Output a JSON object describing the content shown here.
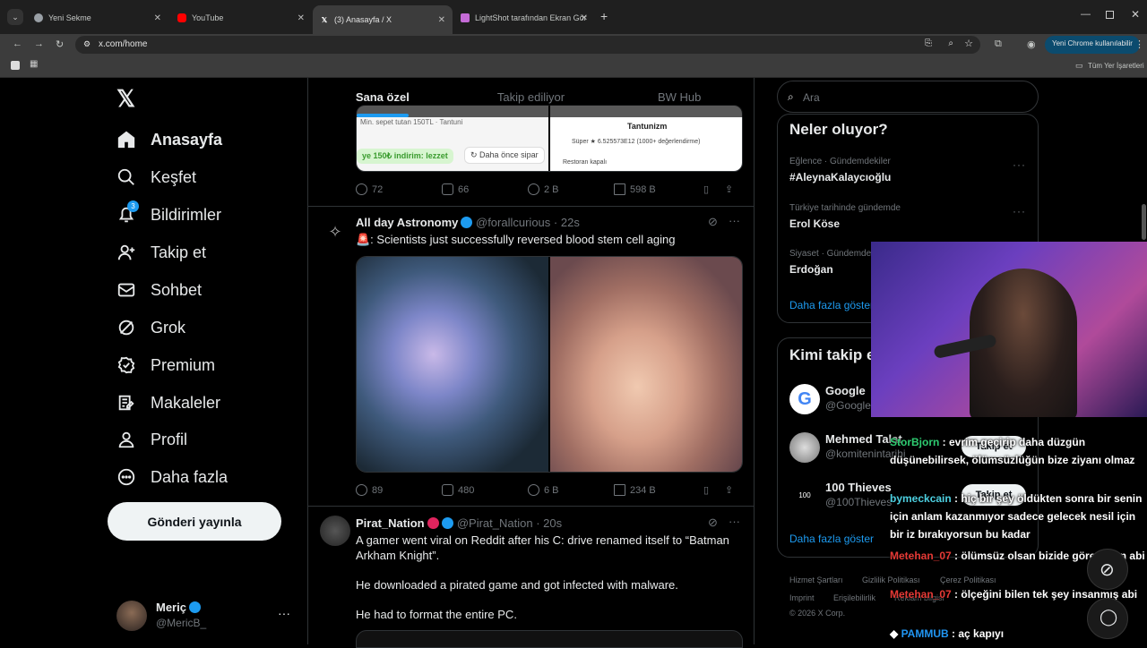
{
  "browser": {
    "tabs": [
      {
        "title": "Yeni Sekme",
        "active": false
      },
      {
        "title": "YouTube",
        "active": false
      },
      {
        "title": "(3) Anasayfa / X",
        "active": true
      },
      {
        "title": "LightShot tarafından Ekran Gör",
        "active": false
      }
    ],
    "url": "x.com/home",
    "profile_label": "Yeni Chrome kullanılabilir",
    "bookmarks_all": "Tüm Yer İşaretleri"
  },
  "nav": {
    "items": [
      {
        "label": "Anasayfa",
        "icon": "home-icon"
      },
      {
        "label": "Keşfet",
        "icon": "search-icon"
      },
      {
        "label": "Bildirimler",
        "icon": "bell-icon",
        "badge": "3"
      },
      {
        "label": "Takip et",
        "icon": "follow-icon"
      },
      {
        "label": "Sohbet",
        "icon": "mail-icon"
      },
      {
        "label": "Grok",
        "icon": "grok-icon"
      },
      {
        "label": "Premium",
        "icon": "premium-icon"
      },
      {
        "label": "Makaleler",
        "icon": "articles-icon"
      },
      {
        "label": "Profil",
        "icon": "profile-icon"
      },
      {
        "label": "Daha fazla",
        "icon": "more-icon"
      }
    ],
    "post_button": "Gönderi yayınla",
    "account": {
      "name": "Meriç",
      "handle": "@MericB_"
    }
  },
  "feed": {
    "tabs": [
      "Sana özel",
      "Takip ediliyor",
      "BW Hub"
    ],
    "prev_post": {
      "card_left_top": "Min. sepet tutan 150TL · Tantuni",
      "card_left_promo": "ye 150₺ indirim: lezzet",
      "card_left_reorder": "Daha önce sipar",
      "card_right_title": "Tantunizm",
      "card_right_rating": "Süper ★ 6.525573E12 (1000+ değerlendirme)",
      "card_right_status": "Restoran kapalı",
      "replies": "72",
      "reposts": "66",
      "likes": "2 B",
      "views": "598 B"
    },
    "posts": [
      {
        "name": "All day Astronomy",
        "handle": "@forallcurious",
        "time": "22s",
        "text": "🚨: Scientists just successfully reversed blood stem cell aging",
        "replies": "89",
        "reposts": "480",
        "likes": "6 B",
        "views": "234 B"
      },
      {
        "name": "Pirat_Nation",
        "handle": "@Pirat_Nation",
        "time": "20s",
        "text1": "A gamer went viral on Reddit after his C: drive renamed itself to “Batman Arkham Knight”.",
        "text2": "He downloaded a pirated game and got infected with malware.",
        "text3": "He had to format the entire PC."
      }
    ]
  },
  "sidebar": {
    "search_placeholder": "Ara",
    "trends_title": "Neler oluyor?",
    "trends": [
      {
        "category": "Eğlence · Gündemdekiler",
        "name": "#AleynaKalaycıoğlu"
      },
      {
        "category": "Türkiye tarihinde gündemde",
        "name": "Erol Köse"
      },
      {
        "category": "Siyaset · Gündemde",
        "name": "Erdoğan"
      }
    ],
    "show_more": "Daha fazla göster",
    "who_title": "Kimi takip et",
    "who": [
      {
        "name": "Google",
        "handle": "@Google"
      },
      {
        "name": "Mehmed Talat",
        "handle": "@komitenintarihi"
      },
      {
        "name": "100 Thieves",
        "handle": "@100Thieves"
      }
    ],
    "follow_label": "Takip et",
    "show_more2": "Daha fazla göster",
    "footer": [
      "Hizmet Şartları",
      "Gizlilik Politikası",
      "Çerez Politikası",
      "Imprint",
      "Erişilebilirlik",
      "Reklam bilgisi",
      "© 2026 X Corp."
    ]
  },
  "chat": [
    {
      "user": "StorBjorn",
      "color": "#2ecc71",
      "msg": " : evrim geçirip daha düzgün düşünebilirsek, ölümsüzlüğün bize ziyanı olmaz"
    },
    {
      "user": "bymeckcain",
      "color": "#4dd0e1",
      "msg": " : hiç bir şey öldükten sonra bir senin için anlam kazanmıyor sadece gelecek nesil için bir iz bırakıyorsun bu kadar"
    },
    {
      "user": "Metehan_07",
      "color": "#e53935",
      "msg": " : ölümsüz olsan bizide göremicen abi"
    },
    {
      "user": "Metehan_07",
      "color": "#e53935",
      "msg": " : ölçeğini bilen tek şey insanmış abi"
    },
    {
      "user": "PAMMUB",
      "color": "#2196f3",
      "msg": " : aç kapıyı"
    }
  ]
}
